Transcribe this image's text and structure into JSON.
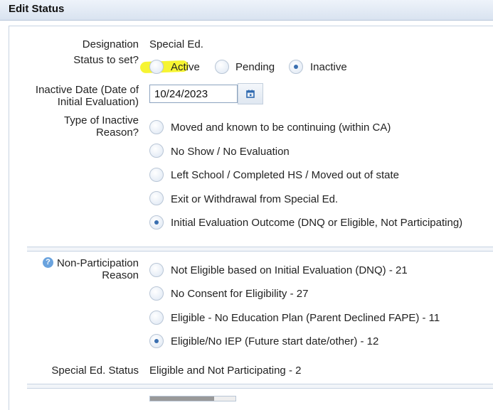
{
  "title": "Edit Status",
  "designation": {
    "label": "Designation",
    "value": "Special Ed."
  },
  "status": {
    "label": "Status to set?",
    "options": [
      {
        "label": "Active",
        "checked": false
      },
      {
        "label": "Pending",
        "checked": false
      },
      {
        "label": "Inactive",
        "checked": true
      }
    ]
  },
  "inactive_date": {
    "label_line1": "Inactive Date (Date of",
    "label_line2": "Initial Evaluation)",
    "value": "10/24/2023",
    "calendar_icon": "calendar-icon"
  },
  "inactive_reason": {
    "label_line1": "Type of Inactive",
    "label_line2": "Reason?",
    "options": [
      {
        "label": "Moved and known to be continuing (within CA)",
        "checked": false
      },
      {
        "label": "No Show / No Evaluation",
        "checked": false
      },
      {
        "label": "Left School / Completed HS / Moved out of state",
        "checked": false
      },
      {
        "label": "Exit or Withdrawal from Special Ed.",
        "checked": false
      },
      {
        "label": "Initial Evaluation Outcome (DNQ or Eligible, Not Participating)",
        "checked": true
      }
    ]
  },
  "non_participation": {
    "help_icon": "?",
    "label_line1": "Non-Participation",
    "label_line2": "Reason",
    "options": [
      {
        "label": "Not Eligible based on Initial Evaluation (DNQ) - 21",
        "checked": false
      },
      {
        "label": "No Consent for Eligibility - 27",
        "checked": false
      },
      {
        "label": "Eligible - No Education Plan (Parent Declined FAPE) - 11",
        "checked": false
      },
      {
        "label": "Eligible/No IEP (Future start date/other) - 12",
        "checked": true
      }
    ]
  },
  "special_ed_status": {
    "label": "Special Ed. Status",
    "value": "Eligible and Not Participating - 2"
  },
  "colors": {
    "highlight": "#f4f20e",
    "accent": "#3a6fb0"
  }
}
